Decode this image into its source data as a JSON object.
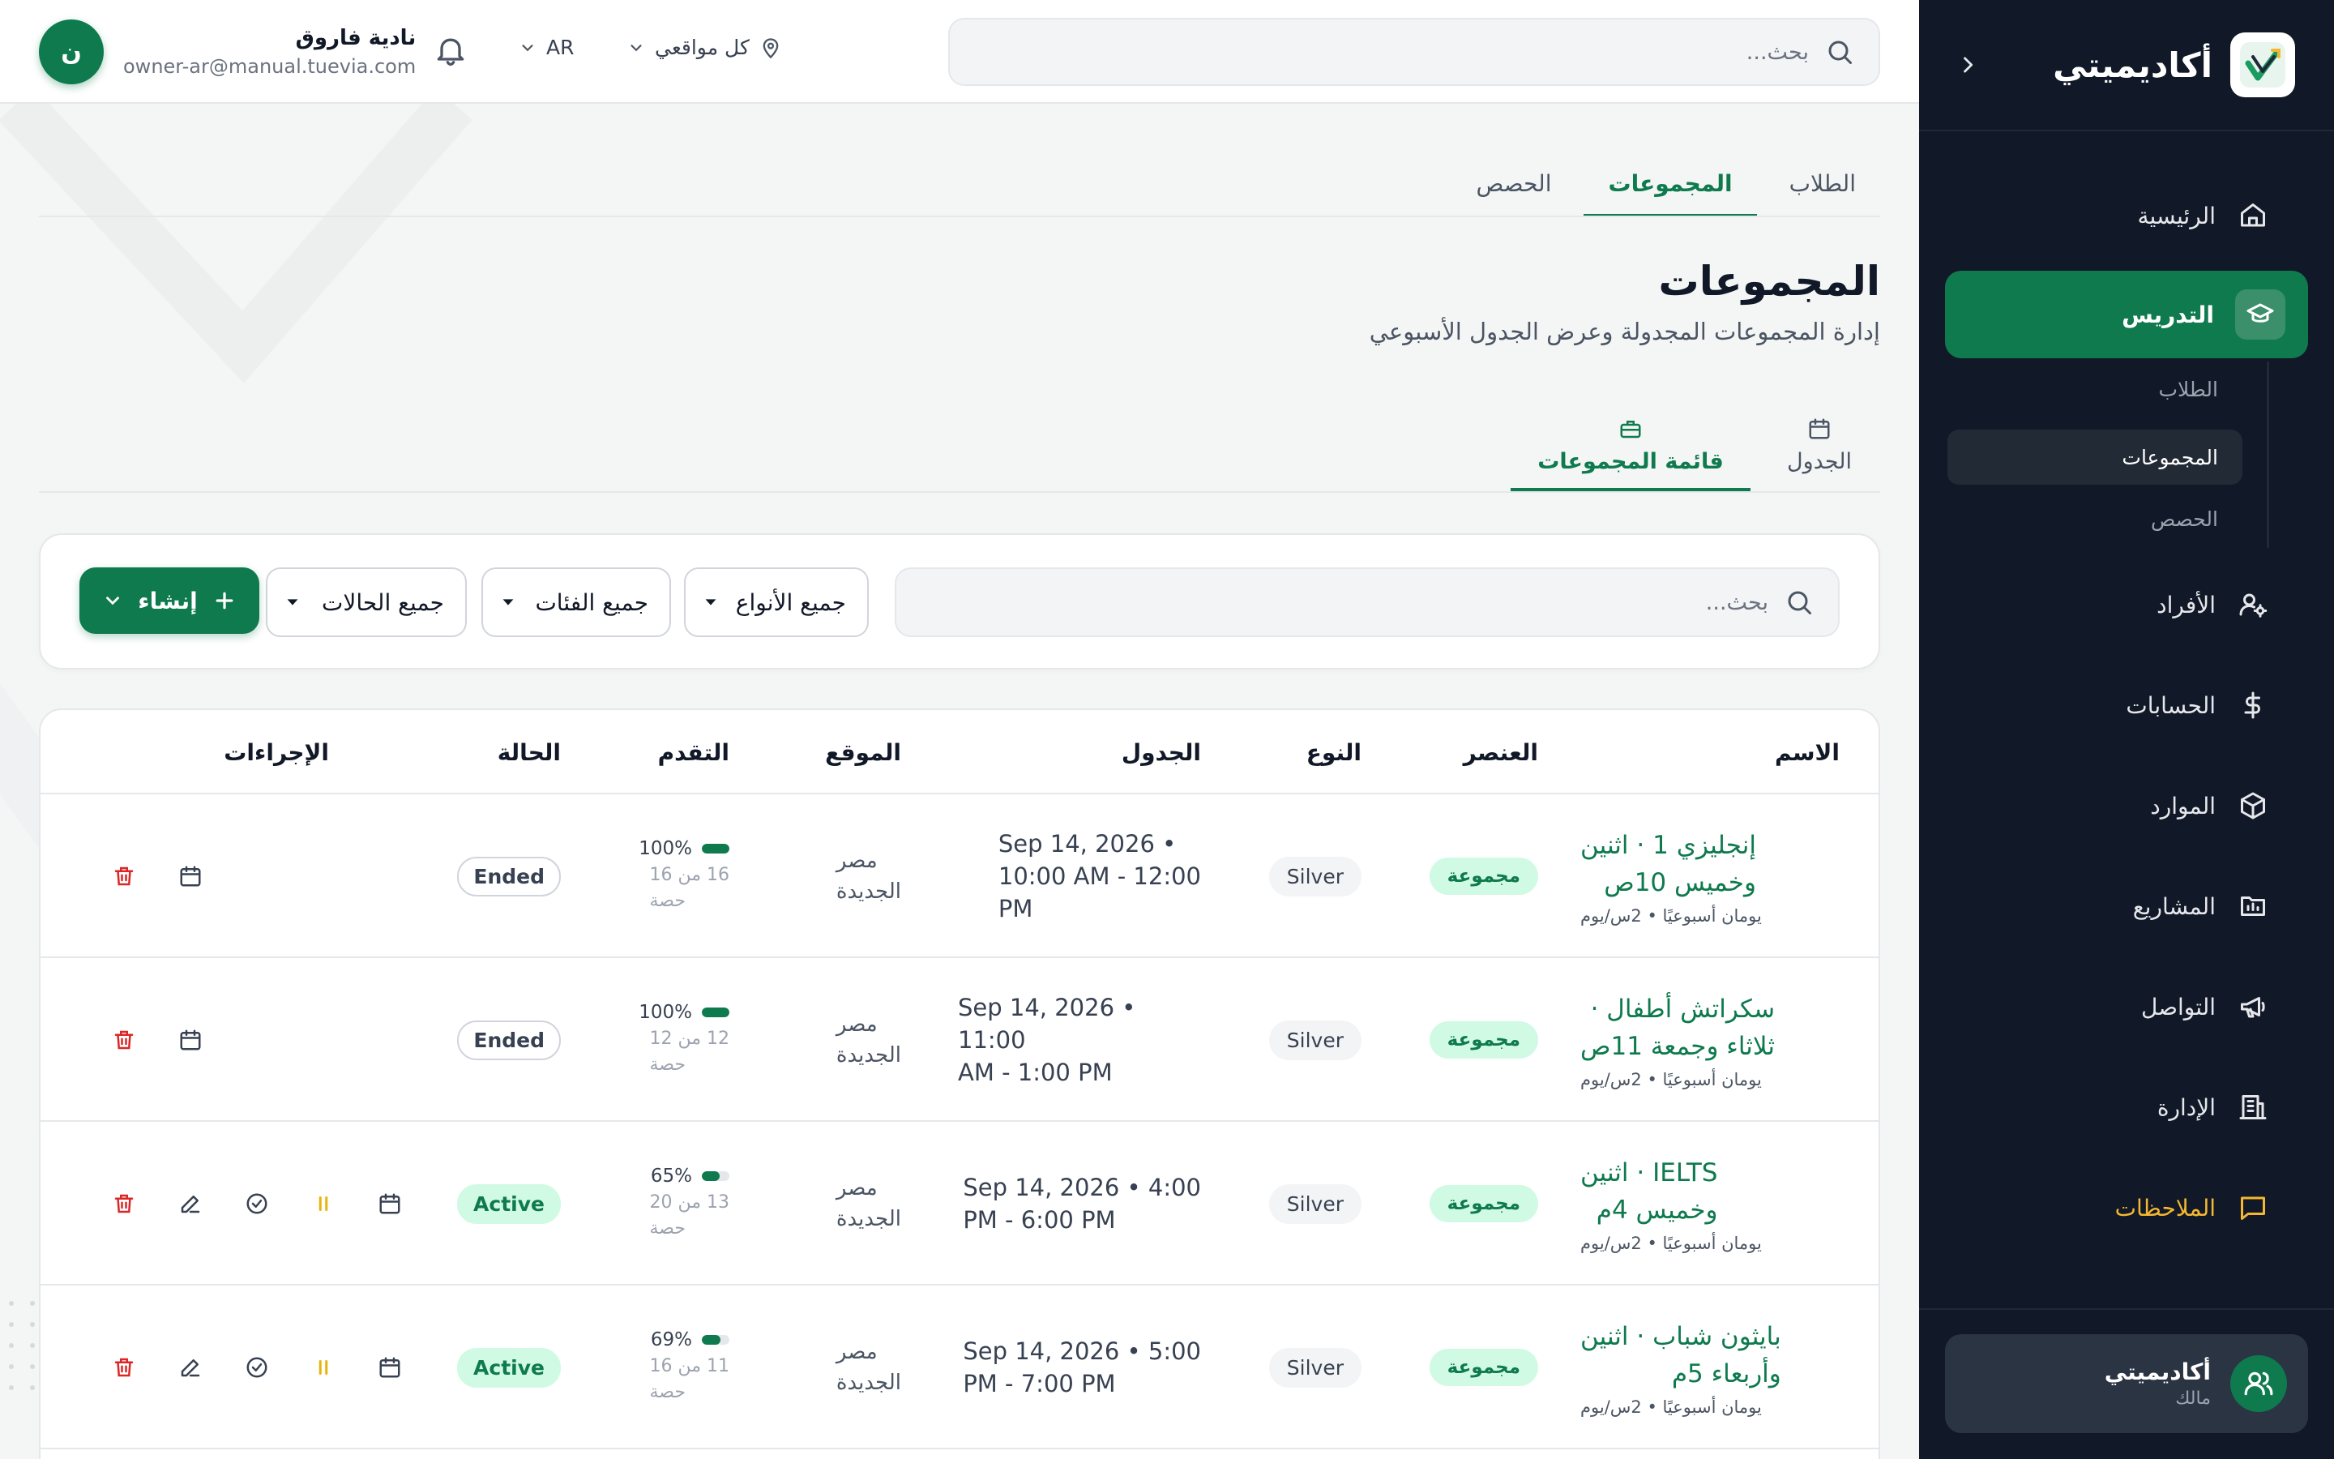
{
  "brand": {
    "name": "أكاديميتي"
  },
  "colors": {
    "primary": "#0e7a4e",
    "sidebar": "#111827",
    "danger": "#dc2626",
    "warning": "#eab308",
    "notes": "#f5b731"
  },
  "sidebar": {
    "items": [
      {
        "label": "الرئيسية",
        "icon": "home-icon"
      },
      {
        "label": "التدريس",
        "icon": "graduation-cap-icon",
        "active": true
      },
      {
        "label": "الأفراد",
        "icon": "user-gear-icon"
      },
      {
        "label": "الحسابات",
        "icon": "dollar-icon"
      },
      {
        "label": "الموارد",
        "icon": "box-icon"
      },
      {
        "label": "المشاريع",
        "icon": "folder-chart-icon"
      },
      {
        "label": "التواصل",
        "icon": "megaphone-icon"
      },
      {
        "label": "الإدارة",
        "icon": "building-icon"
      },
      {
        "label": "الملاحظات",
        "icon": "message-square-icon"
      }
    ],
    "sub_items": [
      {
        "label": "الطلاب"
      },
      {
        "label": "المجموعات",
        "active": true
      },
      {
        "label": "الحصص"
      }
    ],
    "account": {
      "name": "أكاديميتي",
      "role": "مالك"
    }
  },
  "topbar": {
    "search_placeholder": "بحث...",
    "location": "كل مواقعي",
    "language": "AR",
    "user": {
      "initial": "ن",
      "name": "نادية فاروق",
      "email": "owner-ar@manual.tuevia.com"
    }
  },
  "tabs": [
    {
      "label": "الطلاب"
    },
    {
      "label": "المجموعات",
      "active": true
    },
    {
      "label": "الحصص"
    }
  ],
  "page": {
    "title": "المجموعات",
    "subtitle": "إدارة المجموعات المجدولة وعرض الجدول الأسبوعي"
  },
  "view_tabs": [
    {
      "label": "الجدول",
      "icon": "calendar-icon"
    },
    {
      "label": "قائمة المجموعات",
      "icon": "briefcase-icon",
      "active": true
    }
  ],
  "filters": {
    "search_placeholder": "بحث...",
    "type": "جميع الأنواع",
    "category": "جميع الفئات",
    "status": "جميع الحالات",
    "create_label": "إنشاء"
  },
  "table": {
    "headers": {
      "name": "الاسم",
      "element": "العنصر",
      "type": "النوع",
      "schedule": "الجدول",
      "location": "الموقع",
      "progress": "التقدم",
      "status": "الحالة",
      "actions": "الإجراءات"
    },
    "rows": [
      {
        "name_line1": "إنجليزي 1 · اثنين",
        "name_line2": "وخميس 10ص",
        "meta": "يومان أسبوعيًا • 2س/يوم",
        "element": "مجموعة",
        "type": "Silver",
        "schedule_line1": "Sep 14, 2026 •",
        "schedule_line2": "10:00 AM - 12:00",
        "schedule_line3": "PM",
        "location_line1": "مصر",
        "location_line2": "الجديدة",
        "progress_pct": "100%",
        "progress_value": 100,
        "progress_line1": "16 من 16",
        "progress_line2": "حصة",
        "status": "Ended",
        "status_kind": "ended"
      },
      {
        "name_line1": "سكراتش أطفال ·",
        "name_line2": "ثلاثاء وجمعة 11ص",
        "meta": "يومان أسبوعيًا • 2س/يوم",
        "element": "مجموعة",
        "type": "Silver",
        "schedule_line1": "Sep 14, 2026 • 11:00",
        "schedule_line2": "AM - 1:00 PM",
        "schedule_line3": "",
        "location_line1": "مصر",
        "location_line2": "الجديدة",
        "progress_pct": "100%",
        "progress_value": 100,
        "progress_line1": "12 من 12",
        "progress_line2": "حصة",
        "status": "Ended",
        "status_kind": "ended"
      },
      {
        "name_line1": "IELTS · اثنين",
        "name_line2": "وخميس 4م",
        "meta": "يومان أسبوعيًا • 2س/يوم",
        "element": "مجموعة",
        "type": "Silver",
        "schedule_line1": "Sep 14, 2026 • 4:00",
        "schedule_line2": "PM - 6:00 PM",
        "schedule_line3": "",
        "location_line1": "مصر",
        "location_line2": "الجديدة",
        "progress_pct": "65%",
        "progress_value": 65,
        "progress_line1": "13 من 20",
        "progress_line2": "حصة",
        "status": "Active",
        "status_kind": "active"
      },
      {
        "name_line1": "بايثون شباب · اثنين",
        "name_line2": "وأربعاء 5م",
        "meta": "يومان أسبوعيًا • 2س/يوم",
        "element": "مجموعة",
        "type": "Silver",
        "schedule_line1": "Sep 14, 2026 • 5:00",
        "schedule_line2": "PM - 7:00 PM",
        "schedule_line3": "",
        "location_line1": "مصر",
        "location_line2": "الجديدة",
        "progress_pct": "69%",
        "progress_value": 69,
        "progress_line1": "11 من 16",
        "progress_line2": "حصة",
        "status": "Active",
        "status_kind": "active"
      }
    ]
  }
}
